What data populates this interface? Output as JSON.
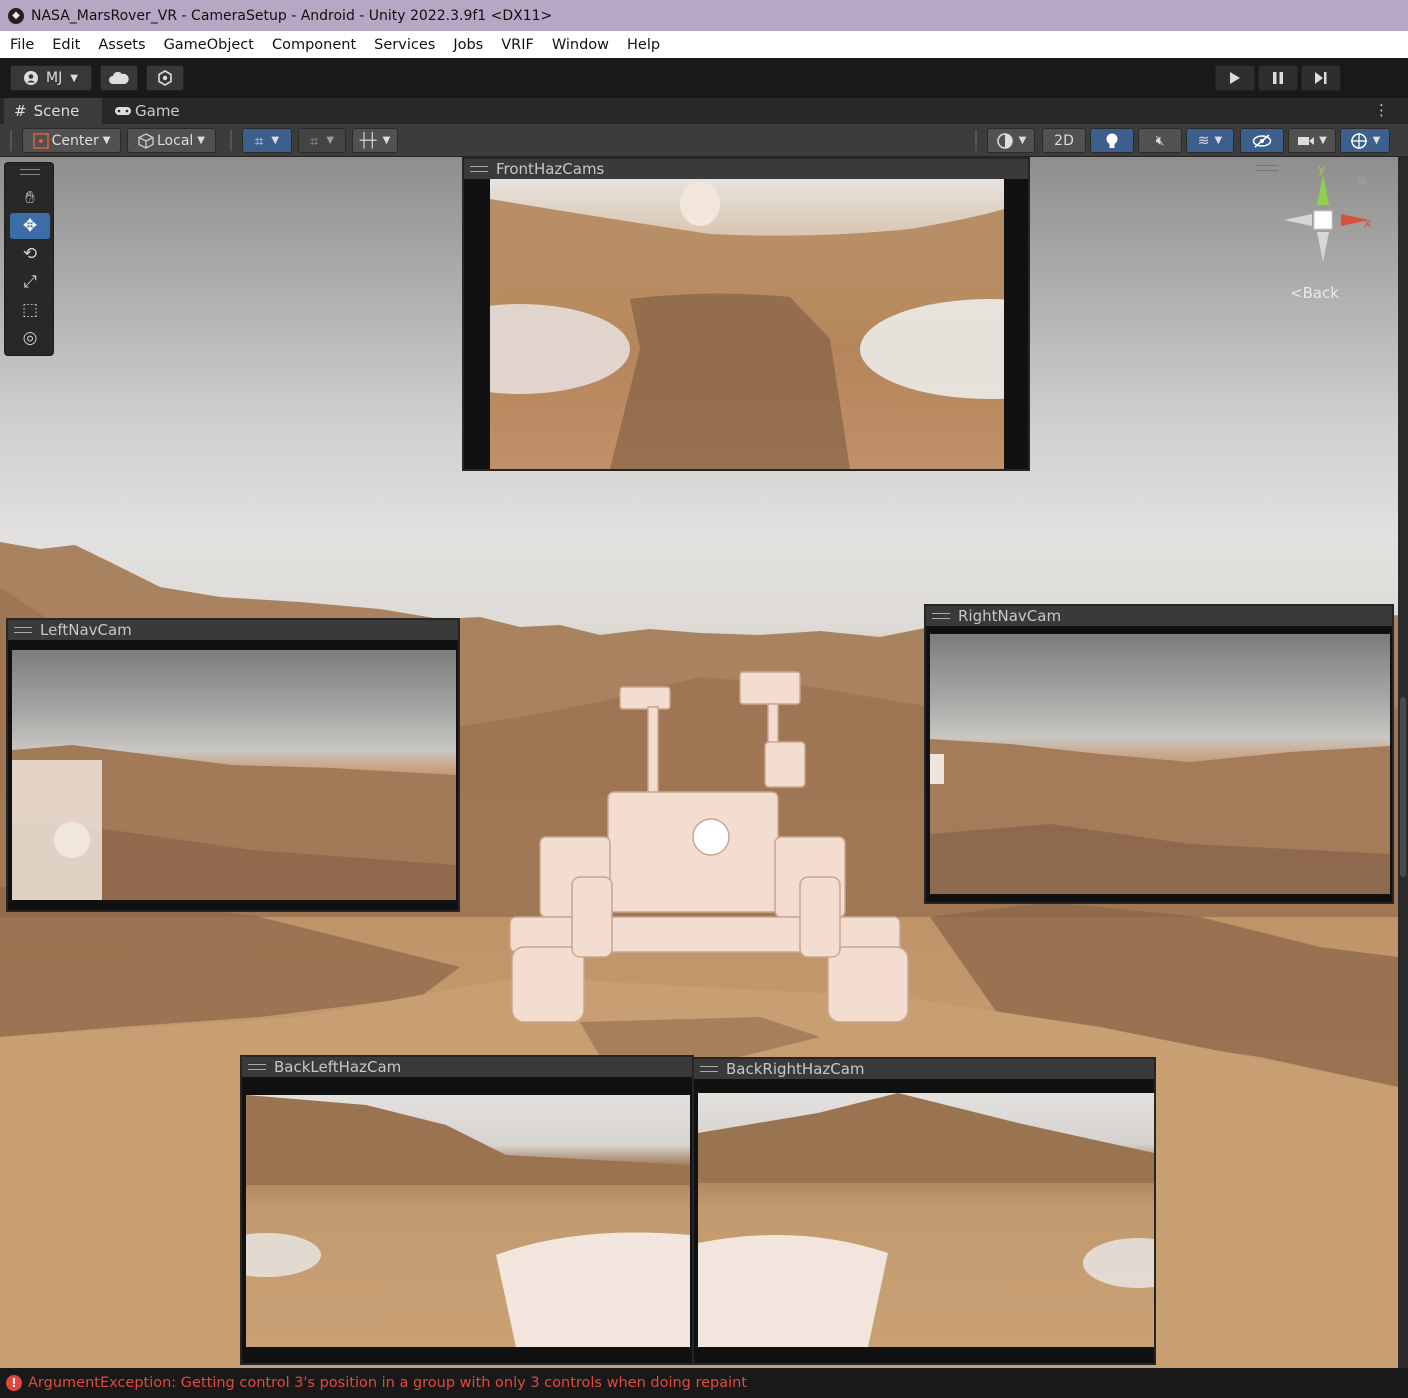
{
  "window": {
    "title": "NASA_MarsRover_VR - CameraSetup - Android - Unity 2022.3.9f1 <DX11>"
  },
  "menu": [
    "File",
    "Edit",
    "Assets",
    "GameObject",
    "Component",
    "Services",
    "Jobs",
    "VRIF",
    "Window",
    "Help"
  ],
  "toolbar": {
    "account": "MJ"
  },
  "tabs": {
    "scene": "Scene",
    "game": "Game"
  },
  "scene_toolbar": {
    "pivot_mode": "Center",
    "pivot_rotation": "Local",
    "mode_2d": "2D"
  },
  "gizmo": {
    "y": "y",
    "x": "x",
    "view": "Back"
  },
  "cameras": {
    "front": "FrontHazCams",
    "left_nav": "LeftNavCam",
    "right_nav": "RightNavCam",
    "back_left": "BackLeftHazCam",
    "back_right": "BackRightHazCam"
  },
  "status": {
    "message": "ArgumentException: Getting control 3's position in a group with only 3 controls when doing repaint"
  },
  "colors": {
    "title_bg": "#b7a6c4",
    "active_blue": "#3d6da6",
    "error_red": "#e04a3c"
  }
}
